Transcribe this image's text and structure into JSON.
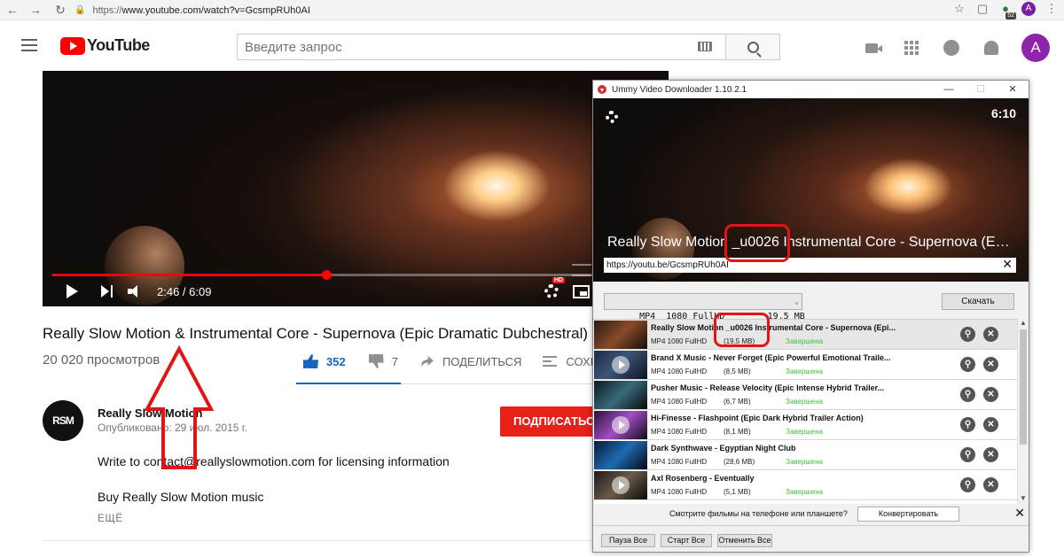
{
  "browser": {
    "url_scheme": "https://",
    "url_rest": "www.youtube.com/watch?v=GcsmpRUh0AI",
    "ext_badge": "52",
    "profile_initial": "A"
  },
  "yt": {
    "logo_text": "YouTube",
    "search_placeholder": "Введите запрос",
    "avatar_initial": "A"
  },
  "player": {
    "current_time": "2:46",
    "duration": "6:09",
    "time_display": "2:46 / 6:09",
    "progress_fraction": 0.45,
    "hd_badge": "HD"
  },
  "video": {
    "title": "Really Slow Motion & Instrumental Core - Supernova (Epic Dramatic Dubchestral)",
    "views": "20 020 просмотров",
    "likes": "352",
    "dislikes": "7",
    "share_label": "ПОДЕЛИТЬСЯ",
    "save_label": "СОХРА",
    "channel_name": "Really Slow Motion",
    "channel_avatar_text": "RSM",
    "published": "Опубликовано: 29 июл. 2015 г.",
    "subscribe_label": "ПОДПИСАТЬСЯ",
    "description_line1": "Write to contact@reallyslowmotion.com for licensing information",
    "description_line2": "Buy Really Slow Motion music",
    "more_label": "ЕЩЁ"
  },
  "ummy": {
    "window_title": "Ummy Video Downloader 1.10.2.1",
    "duration": "6:10",
    "video_title": "Really Slow Motion _u0026 Instrumental Core - Supernova (Epi...",
    "url": "https://youtu.be/GcsmpRUh0AI",
    "format_selected": "MP4  1080 FullHD        19,5 MB",
    "download_label": "Скачать",
    "items": [
      {
        "title": "Really Slow Motion _u0026 Instrumental Core - Supernova (Epi...",
        "format": "MP4  1080 FullHD",
        "size": "(19,5 MB)",
        "status": "Завершена"
      },
      {
        "title": "Brand X Music - Never Forget (Epic Powerful Emotional Traile...",
        "format": "MP4  1080 FullHD",
        "size": "(8,5 MB)",
        "status": "Завершена"
      },
      {
        "title": "Pusher Music - Release Velocity (Epic Intense Hybrid Trailer...",
        "format": "MP4  1080 FullHD",
        "size": "(6,7 MB)",
        "status": "Завершена"
      },
      {
        "title": "Hi-Finesse - Flashpoint (Epic Dark Hybrid Trailer Action)",
        "format": "MP4  1080 FullHD",
        "size": "(8,1 MB)",
        "status": "Завершена"
      },
      {
        "title": "Dark Synthwave - Egyptian Night Club",
        "format": "MP4  1080 FullHD",
        "size": "(28,6 MB)",
        "status": "Завершена"
      },
      {
        "title": "Axl Rosenberg - Eventually",
        "format": "MP4  1080 FullHD",
        "size": "(5,1 MB)",
        "status": "Завершена"
      }
    ],
    "promo_text": "Смотрите фильмы на телефоне или планшете?",
    "convert_label": "Конвертировать",
    "pause_all": "Пауза Все",
    "start_all": "Старт Все",
    "cancel_all": "Отменить Все"
  },
  "colors": {
    "yt_red": "#ff0000",
    "like_blue": "#1565c0",
    "status_green": "#3fbf3f",
    "annotation_red": "#e31414"
  }
}
